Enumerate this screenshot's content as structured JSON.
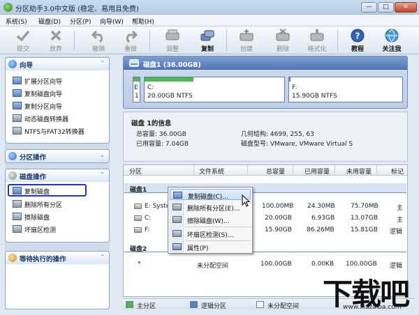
{
  "window": {
    "title": "分区助手3.0中文版 (稳定、易用且免费)",
    "min_glyph": "—",
    "max_glyph": "□",
    "close_glyph": "✕"
  },
  "menu": [
    "系统(S)",
    "磁盘(D)",
    "分区(P)",
    "向导(W)",
    "帮助(H)"
  ],
  "toolbar": {
    "submit": "提交",
    "discard": "放弃",
    "undo": "撤销",
    "redo": "重做",
    "resize": "调整",
    "copy": "复制",
    "create": "创建",
    "delete": "删除",
    "format": "格式化",
    "tutorial": "教程",
    "follow": "关注我"
  },
  "left": {
    "wizard": {
      "title": "向导",
      "chevron": "⌃",
      "items": [
        "扩展分区向导",
        "复制磁盘向导",
        "复制分区向导",
        "动态磁盘转换器",
        "NTFS与FAT32转换器"
      ]
    },
    "partition_ops": {
      "title": "分区操作",
      "chevron": "⌄"
    },
    "disk_ops": {
      "title": "磁盘操作",
      "chevron": "⌃",
      "items": [
        "复制磁盘",
        "删除所有分区",
        "擦除磁盘",
        "坏扇区检测"
      ]
    },
    "pending": {
      "title": "等待执行的操作",
      "chevron": "⌃"
    }
  },
  "diskmap": {
    "header": "磁盘1 (36.00GB)",
    "small_part": {
      "l1": "E",
      "l2": "1"
    },
    "part_c": {
      "letter": "C:",
      "info": "20.00GB NTFS",
      "used_pct": 35
    },
    "part_f": {
      "letter": "F:",
      "info": "15.90GB NTFS",
      "used_pct": 1
    }
  },
  "info": {
    "heading": "磁盘 1的信息",
    "total": "总容量: 36.00GB",
    "used": "已用容量: 7.04GB",
    "geometry": "几何结构: 4699, 255, 63",
    "model": "磁盘型号: VMware, VMware Virtual S"
  },
  "table": {
    "headers": [
      "分区",
      "文件系统",
      "总容量",
      "已用容量",
      "未用容量",
      "标记"
    ],
    "group1": "磁盘1",
    "rows1": [
      {
        "name": "E: Syster",
        "total": "100.00MB",
        "used": "24.30MB",
        "free": "75.70MB",
        "flag": "主"
      },
      {
        "name": "C:",
        "total": "20.00GB",
        "used": "6.93GB",
        "free": "13.07GB",
        "flag": "主"
      },
      {
        "name": "F:",
        "total": "15.90GB",
        "used": "86.26MB",
        "free": "15.81GB",
        "flag": "逻辑"
      }
    ],
    "group2": "磁盘2",
    "rows2": [
      {
        "name": "*",
        "fs": "未分配空间",
        "total": "100.00GB",
        "used": "0.00KB",
        "free": "100.00GB",
        "flag": "逻辑"
      }
    ]
  },
  "legend": {
    "primary": "主分区",
    "logical": "逻辑分区",
    "unalloc": "未分配空间"
  },
  "context_menu": [
    "复制磁盘(C)...",
    "删除所有分区(E)...",
    "擦除磁盘(W)...",
    "坏扇区检测(S)...",
    "属性(P)"
  ],
  "watermark": {
    "text": "下载吧",
    "url": "www.xiazaiba.com"
  },
  "colors": {
    "accent": "#3a66a8",
    "primary_part": "#4cb84a",
    "logical_part": "#5a7fc4",
    "selection_border": "#1b33c8",
    "disk_header": "#5279b6"
  }
}
